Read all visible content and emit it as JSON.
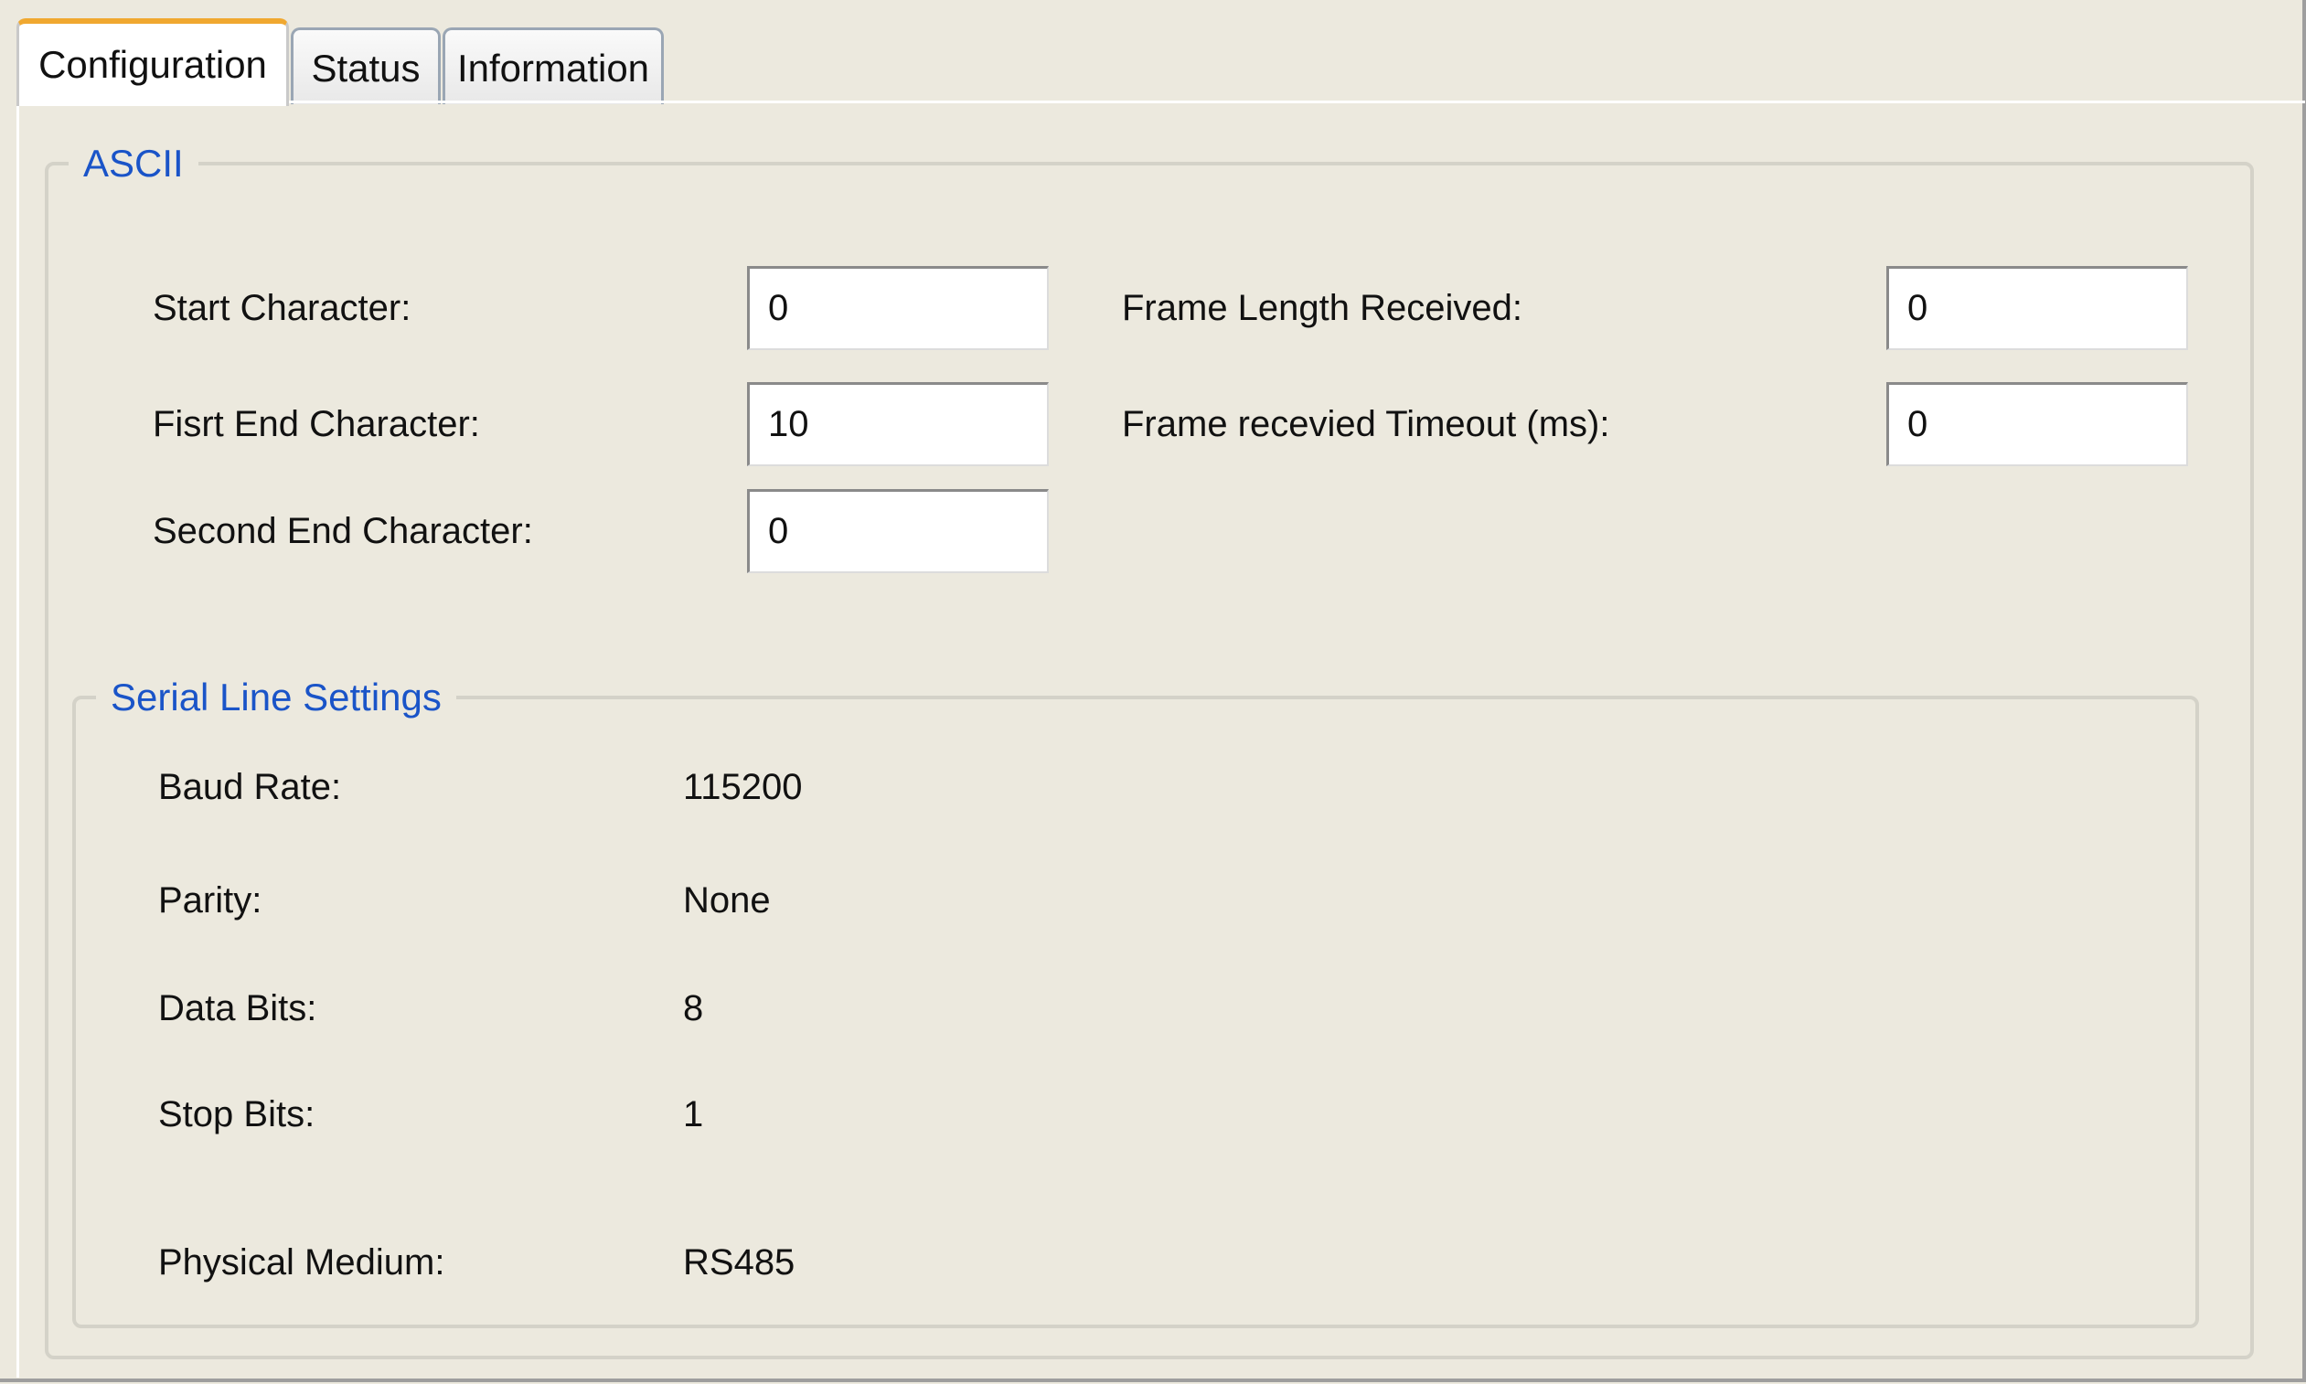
{
  "tabs": [
    {
      "label": "Configuration",
      "active": true
    },
    {
      "label": "Status",
      "active": false
    },
    {
      "label": "Information",
      "active": false
    }
  ],
  "ascii": {
    "legend": "ASCII",
    "start_character": {
      "label": "Start Character:",
      "value": "0"
    },
    "first_end_character": {
      "label": "Fisrt End Character:",
      "value": "10"
    },
    "second_end_character": {
      "label": "Second End Character:",
      "value": "0"
    },
    "frame_length_received": {
      "label": "Frame Length Received:",
      "value": "0"
    },
    "frame_received_timeout": {
      "label": "Frame recevied Timeout (ms):",
      "value": "0"
    }
  },
  "serial_line": {
    "legend": "Serial Line Settings",
    "baud_rate": {
      "label": "Baud Rate:",
      "value": "115200"
    },
    "parity": {
      "label": "Parity:",
      "value": "None"
    },
    "data_bits": {
      "label": "Data Bits:",
      "value": "8"
    },
    "stop_bits": {
      "label": "Stop Bits:",
      "value": "1"
    },
    "physical_medium": {
      "label": "Physical Medium:",
      "value": "RS485"
    }
  },
  "colors": {
    "background": "#ece9de",
    "legend_text": "#1a54c8",
    "active_tab_accent": "#f0a830"
  }
}
